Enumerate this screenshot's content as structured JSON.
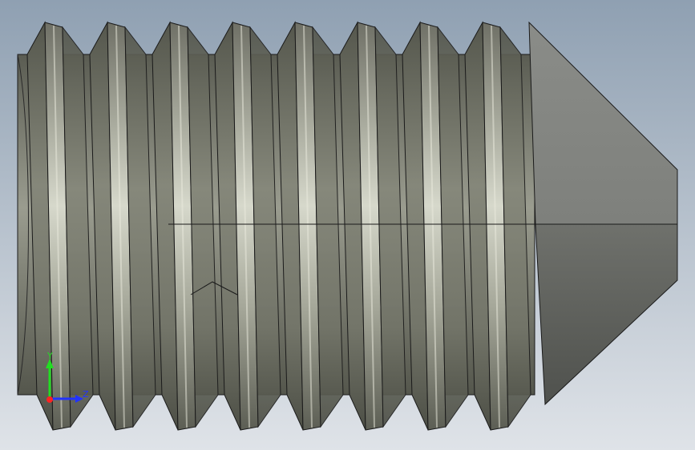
{
  "viewport": {
    "background_top": "#8fa0b2",
    "background_bottom": "#dfe3e8"
  },
  "model": {
    "thread_count": 8,
    "crest_highlight": "#d4d6c8",
    "flank_dark": "#5e6055",
    "flank_mid": "#8e9083",
    "root_color": "#6f7166",
    "cone_light": "#9a9c97",
    "cone_dark": "#5f615c",
    "edge_color": "#1a1a1a"
  },
  "triad": {
    "y_label": "Y",
    "z_label": "Z",
    "y_color": "#22dd22",
    "z_color": "#2233ff",
    "x_color": "#ff2222"
  }
}
